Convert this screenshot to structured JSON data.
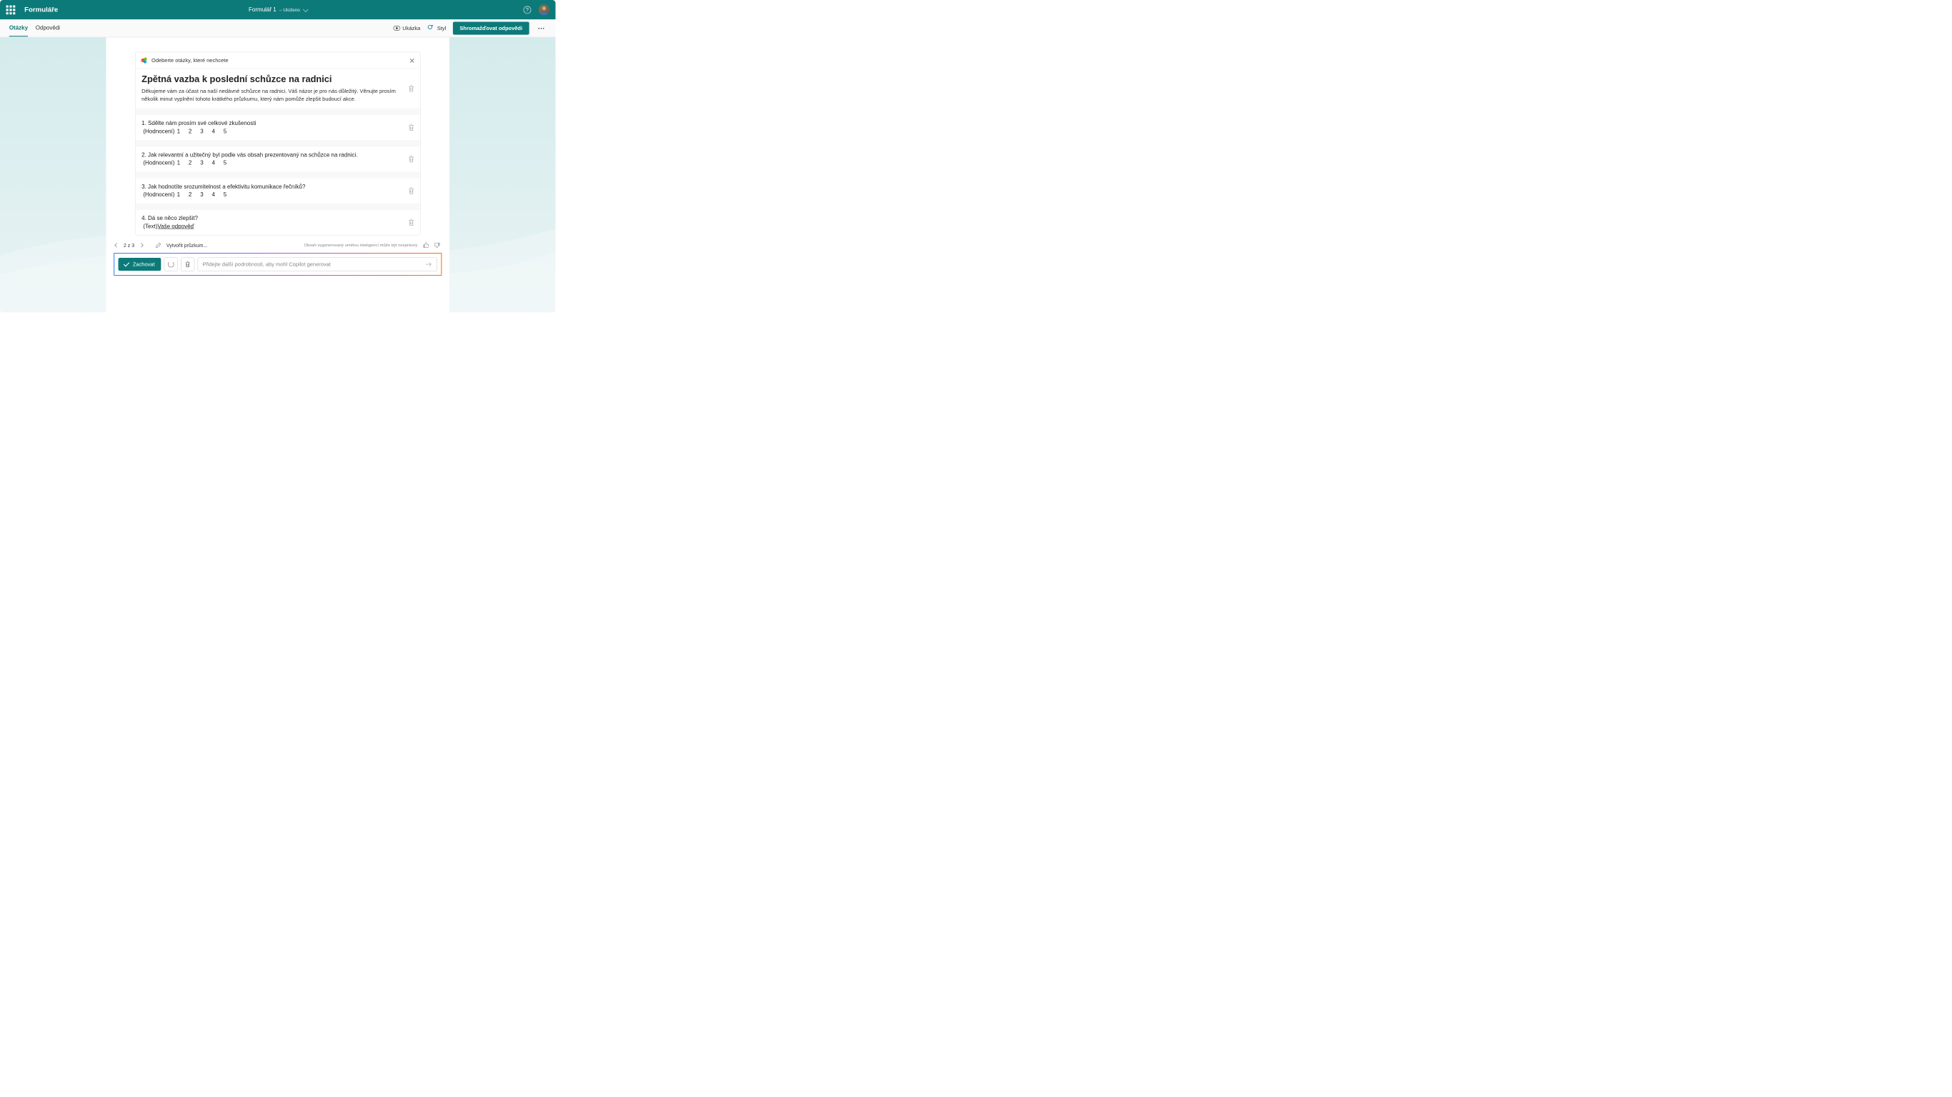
{
  "header": {
    "app_name": "Formuláře",
    "form_title": "Formulář 1",
    "saved_label": "– Uloženo"
  },
  "toolbar": {
    "tab_questions": "Otázky",
    "tab_responses": "Odpovědi",
    "preview": "Ukázka",
    "style": "Styl",
    "collect": "Shromažďovat odpovědi"
  },
  "suggestions": {
    "banner": "Odeberte otázky, které nechcete",
    "form_title": "Zpětná vazba k poslední schůzce na radnici",
    "form_desc": "Děkujeme vám za účast na naší nedávné schůzce na radnici. Váš názor je pro nás důležitý. Věnujte prosím několik minut vyplnění tohoto krátkého průzkumu, který nám pomůže zlepšit budoucí akce.",
    "questions": [
      {
        "num": "1.",
        "text": "Sdělte nám prosím své celkové zkušenosti",
        "type_label": "(Hodnocení)",
        "scale": "1   2   3   4   5"
      },
      {
        "num": "2.",
        "text": "Jak relevantní a užitečný byl podle vás obsah prezentovaný na schůzce na radnici.",
        "type_label": "(Hodnocení)",
        "scale": "1   2   3   4   5"
      },
      {
        "num": "3.",
        "text": "Jak hodnotíte srozumitelnost a efektivitu komunikace řečníků?",
        "type_label": "(Hodnocení)",
        "scale": "1   2   3   4   5"
      },
      {
        "num": "4.",
        "text": "Dá se něco zlepšit?",
        "type_label": "(Text)",
        "answer": "Vaše odpověď"
      }
    ]
  },
  "footer": {
    "page": "2 z 3",
    "create_survey": "Vytvořit průzkum...",
    "ai_disclaimer": "Obsah vygenerovaný umělou inteligencí může být nesprávný",
    "keep": "Zachovat",
    "prompt_placeholder": "Přidejte další podrobnosti, aby mohl Copilot generovat"
  }
}
